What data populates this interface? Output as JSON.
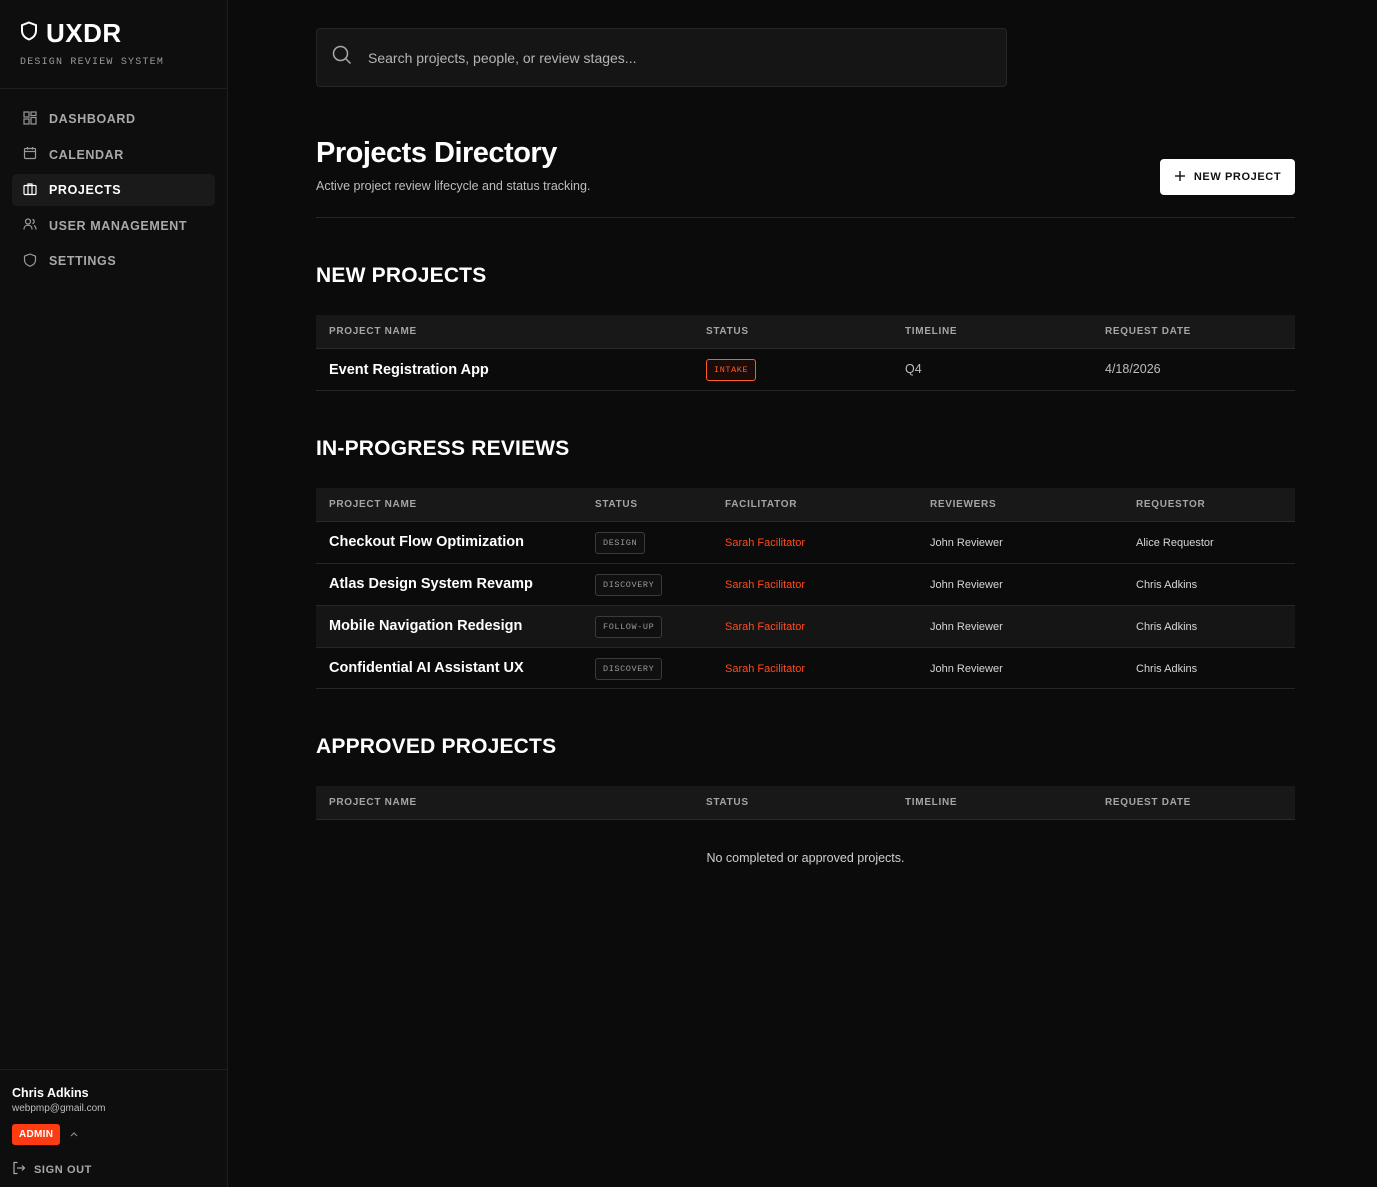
{
  "brand": {
    "title": "UXDR",
    "subtitle": "DESIGN REVIEW SYSTEM"
  },
  "nav": [
    {
      "label": "DASHBOARD",
      "icon": "grid-icon"
    },
    {
      "label": "CALENDAR",
      "icon": "calendar-icon"
    },
    {
      "label": "PROJECTS",
      "icon": "briefcase-icon",
      "active": true
    },
    {
      "label": "USER MANAGEMENT",
      "icon": "users-icon"
    },
    {
      "label": "SETTINGS",
      "icon": "shield-icon"
    }
  ],
  "user": {
    "name": "Chris Adkins",
    "email": "webpmp@gmail.com",
    "role": "ADMIN",
    "signout": "SIGN OUT"
  },
  "search": {
    "placeholder": "Search projects, people, or review stages..."
  },
  "header": {
    "title": "Projects Directory",
    "subtitle": "Active project review lifecycle and status tracking.",
    "new_button": "NEW PROJECT"
  },
  "new_projects": {
    "title": "NEW PROJECTS",
    "columns": [
      "PROJECT NAME",
      "STATUS",
      "TIMELINE",
      "REQUEST DATE"
    ],
    "rows": [
      {
        "name": "Event Registration App",
        "status": "INTAKE",
        "timeline": "Q4",
        "date": "4/18/2026"
      }
    ]
  },
  "in_progress": {
    "title": "IN-PROGRESS REVIEWS",
    "columns": [
      "PROJECT NAME",
      "STATUS",
      "FACILITATOR",
      "REVIEWERS",
      "REQUESTOR"
    ],
    "rows": [
      {
        "name": "Checkout Flow Optimization",
        "status": "DESIGN",
        "facilitator": "Sarah Facilitator",
        "reviewers": "John Reviewer",
        "requestor": "Alice Requestor"
      },
      {
        "name": "Atlas Design System Revamp",
        "status": "DISCOVERY",
        "facilitator": "Sarah Facilitator",
        "reviewers": "John Reviewer",
        "requestor": "Chris Adkins"
      },
      {
        "name": "Mobile Navigation Redesign",
        "status": "FOLLOW-UP",
        "facilitator": "Sarah Facilitator",
        "reviewers": "John Reviewer",
        "requestor": "Chris Adkins"
      },
      {
        "name": "Confidential AI Assistant UX",
        "status": "DISCOVERY",
        "facilitator": "Sarah Facilitator",
        "reviewers": "John Reviewer",
        "requestor": "Chris Adkins"
      }
    ]
  },
  "approved": {
    "title": "APPROVED PROJECTS",
    "columns": [
      "PROJECT NAME",
      "STATUS",
      "TIMELINE",
      "REQUEST DATE"
    ],
    "empty": "No completed or approved projects."
  },
  "colors": {
    "accent": "#ff3b12",
    "background": "#0b0b0b",
    "sidebar": "#0e0e0e"
  }
}
